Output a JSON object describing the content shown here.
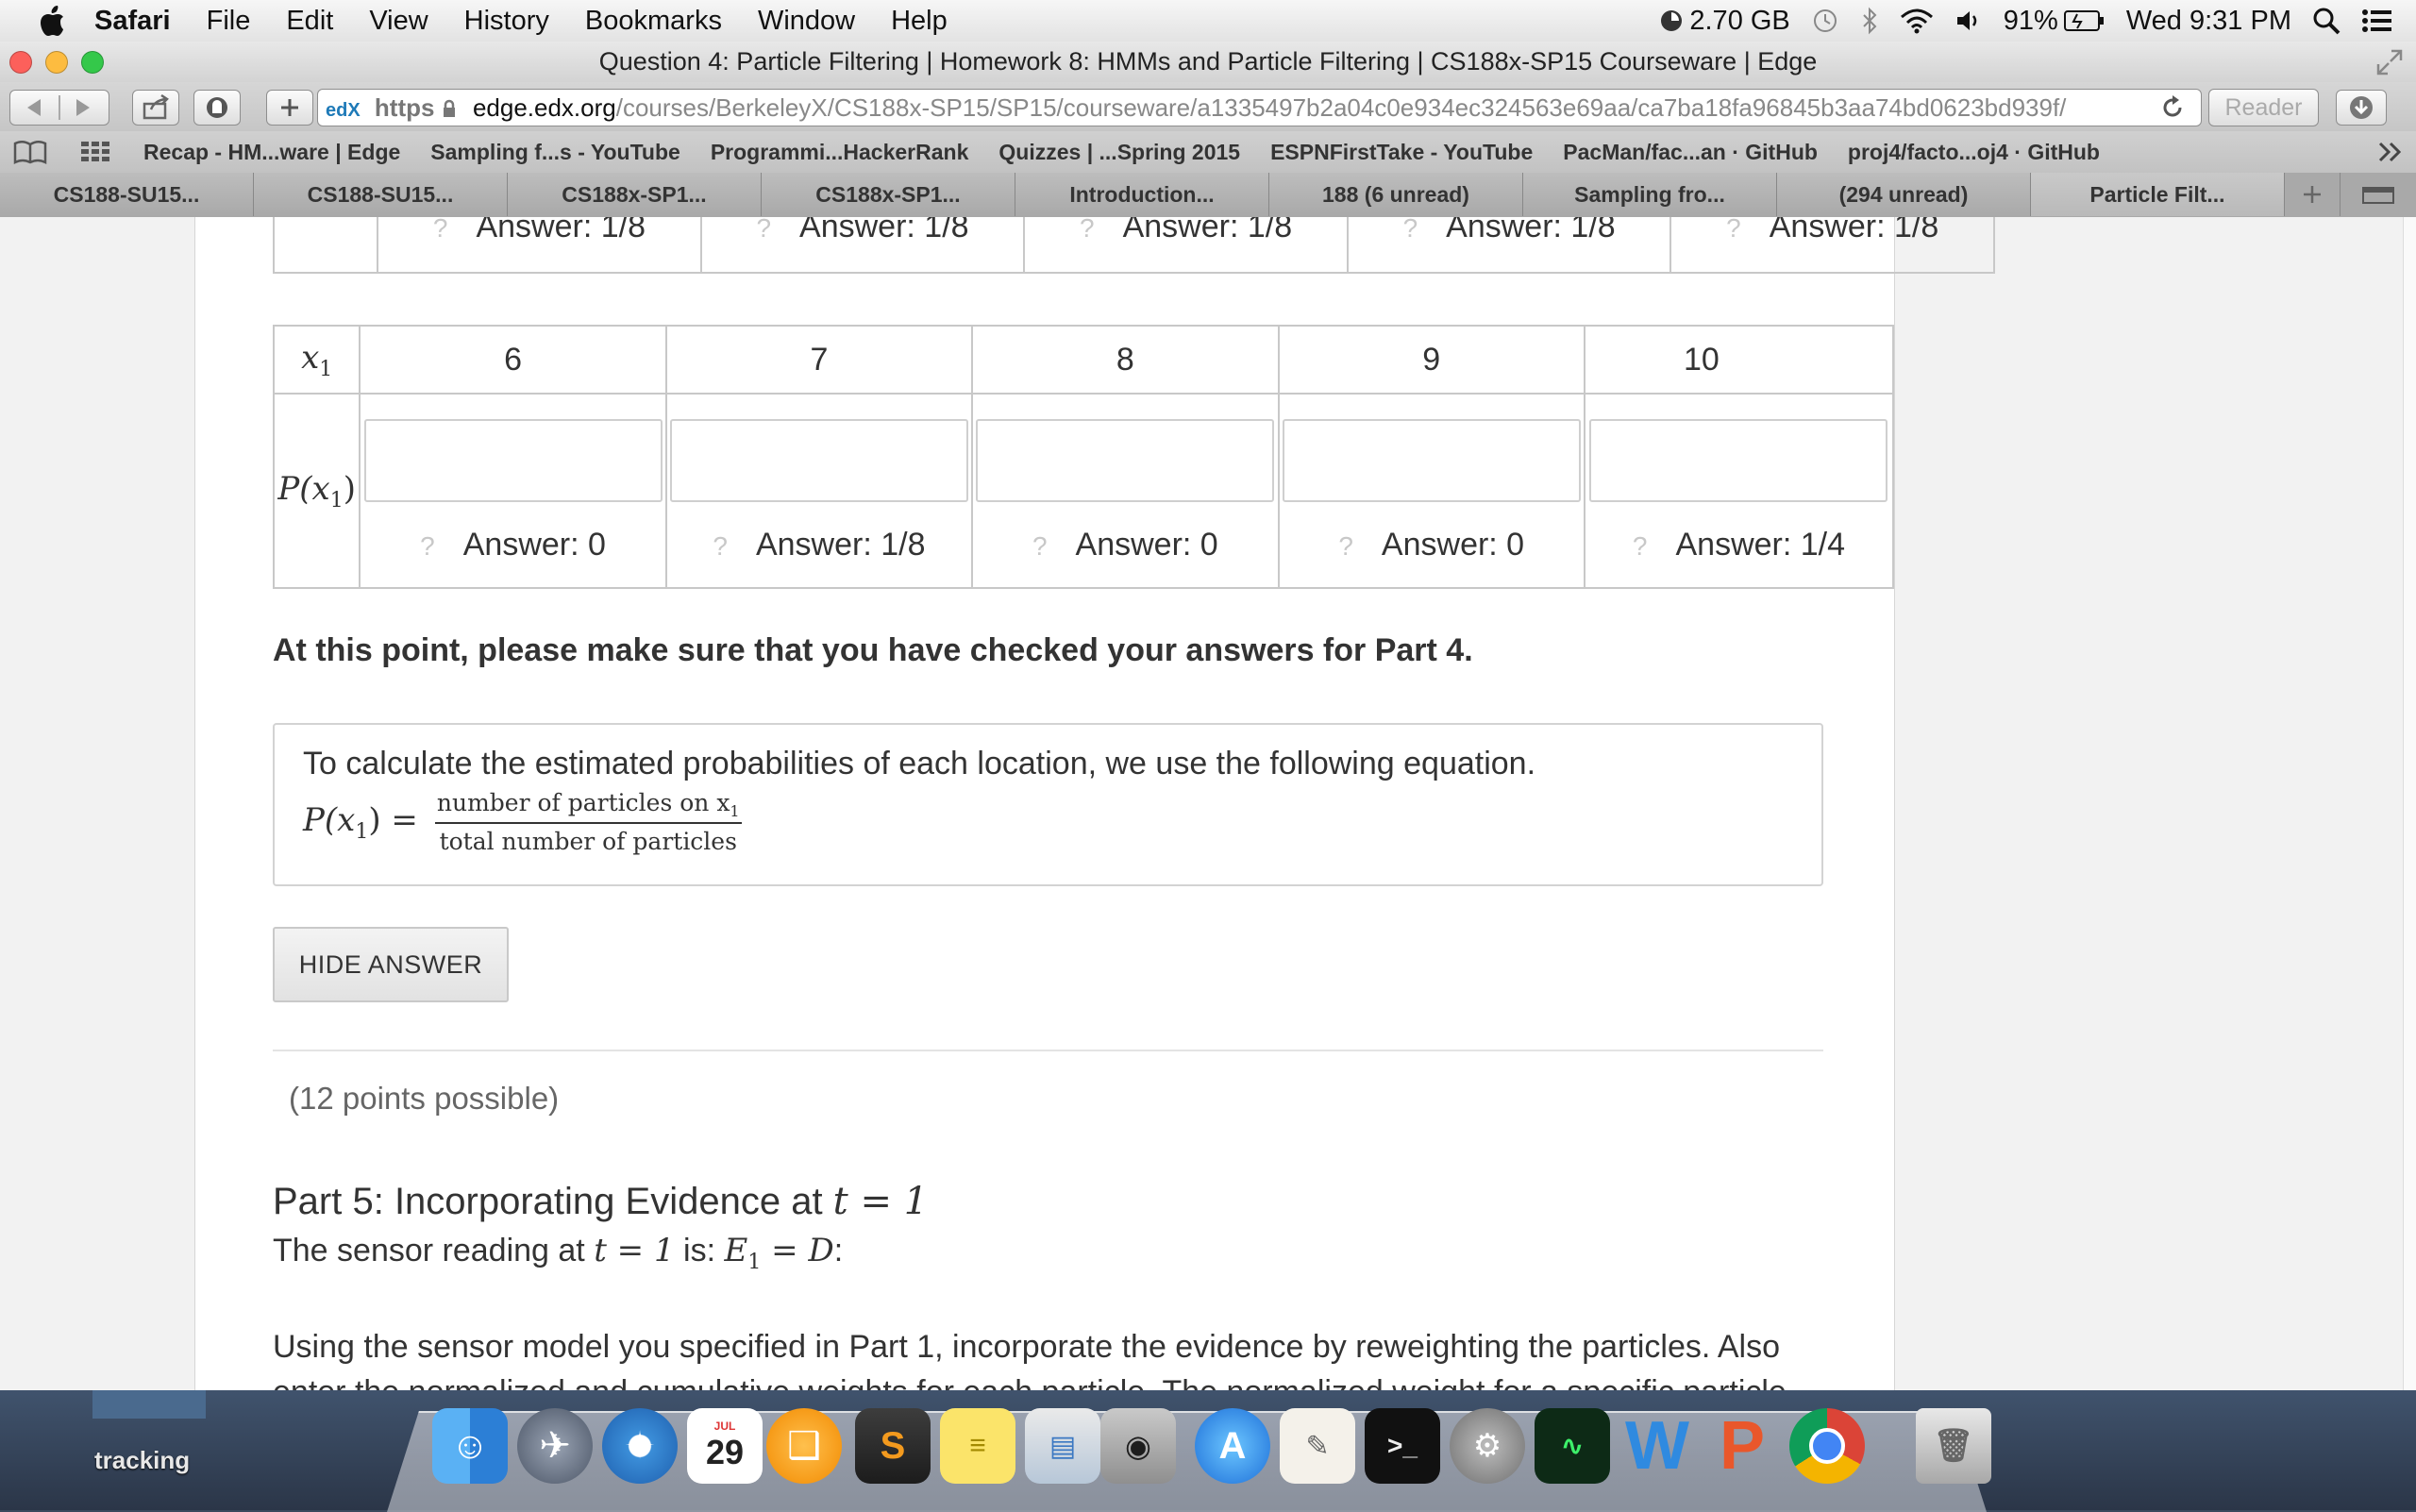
{
  "menubar": {
    "app": "Safari",
    "items": [
      "File",
      "Edit",
      "View",
      "History",
      "Bookmarks",
      "Window",
      "Help"
    ],
    "memory": "2.70 GB",
    "battery": "91%",
    "clock": "Wed 9:31 PM"
  },
  "window": {
    "title": "Question 4: Particle Filtering | Homework 8: HMMs and Particle Filtering | CS188x-SP15 Courseware | Edge"
  },
  "toolbar": {
    "url_badge": "edX",
    "url_scheme": "https",
    "url_host": "edge.edx.org",
    "url_path": "/courses/BerkeleyX/CS188x-SP15/SP15/courseware/a1335497b2a04c0e934ec324563e69aa/ca7ba18fa96845b3aa74bd0623bd939f/",
    "reader_label": "Reader"
  },
  "bookmarks": [
    "Recap - HM...ware | Edge",
    "Sampling f...s - YouTube",
    "Programmi...HackerRank",
    "Quizzes | ...Spring 2015",
    "ESPNFirstTake - YouTube",
    "PacMan/fac...an · GitHub",
    "proj4/facto...oj4 · GitHub"
  ],
  "tabs": [
    "CS188-SU15...",
    "CS188-SU15...",
    "CS188x-SP1...",
    "CS188x-SP1...",
    "Introduction...",
    "188 (6 unread)",
    "Sampling fro...",
    "(294 unread)",
    "Particle Filt..."
  ],
  "prev_table": {
    "answers": [
      "Answer: 1/8",
      "Answer: 1/8",
      "Answer: 1/8",
      "Answer: 1/8",
      "Answer: 1/8"
    ]
  },
  "table": {
    "row_label_x": "x",
    "row_label_p": "P(x",
    "subscript": "1",
    "columns": [
      "6",
      "7",
      "8",
      "9",
      "10"
    ],
    "answers": [
      "Answer: 0",
      "Answer: 1/8",
      "Answer: 0",
      "Answer: 0",
      "Answer: 1/4"
    ]
  },
  "check_note": "At this point, please make sure that you have checked your answers for Part 4.",
  "equation_box": {
    "intro": "To calculate the estimated probabilities of each location, we use the following equation.",
    "lhs": "P(x",
    "lhs_sub": "1",
    "numerator": "number of particles on x",
    "numerator_sub": "1",
    "denominator": "total number of particles"
  },
  "hide_answer_label": "HIDE ANSWER",
  "points": "(12 points possible)",
  "part5": {
    "title_prefix": "Part 5: Incorporating Evidence at ",
    "title_math": "t = 1",
    "sensor_prefix": "The sensor reading at ",
    "sensor_t": "t = 1",
    "sensor_is": " is: ",
    "sensor_math": "E",
    "sensor_math_sub": "1",
    "sensor_math_rest": " = D",
    "sensor_colon": ":",
    "body": "Using the sensor model you specified in Part 1, incorporate the evidence by reweighting the particles. Also enter the normalized and cumulative weights for each particle. The normalized weight for a specific particle"
  },
  "desktop": {
    "tracking_label": "tracking",
    "calendar_month": "JUL",
    "calendar_day": "29"
  },
  "colors": {
    "accent": "#1e7ab8",
    "border": "#c8c8c8"
  }
}
